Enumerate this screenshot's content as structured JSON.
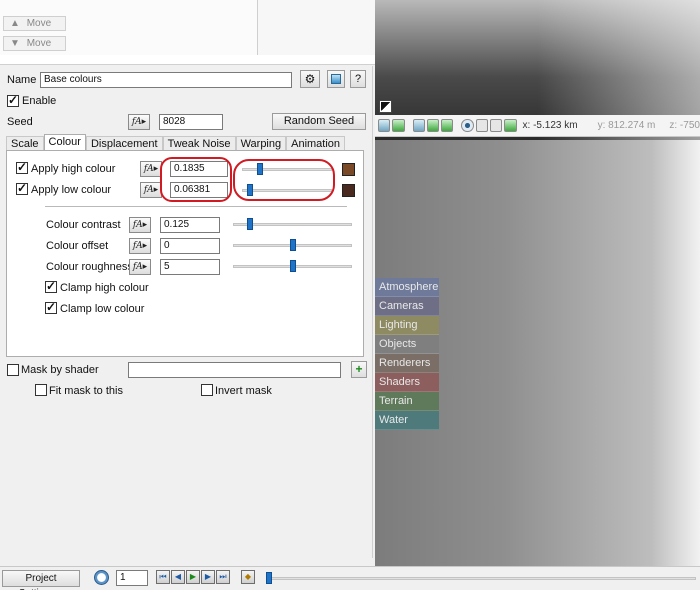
{
  "top_panel": {
    "move_up_label": "Move",
    "move_down_label": "Move"
  },
  "node": {
    "name_label": "Name",
    "name_value": "Base colours",
    "enable_label": "Enable",
    "enable_checked": true,
    "seed_label": "Seed",
    "seed_value": "8028",
    "random_seed_label": "Random Seed",
    "help_label": "?"
  },
  "tabs": [
    {
      "label": "Scale",
      "active": false
    },
    {
      "label": "Colour",
      "active": true
    },
    {
      "label": "Displacement",
      "active": false
    },
    {
      "label": "Tweak Noise",
      "active": false
    },
    {
      "label": "Warping",
      "active": false
    },
    {
      "label": "Animation",
      "active": false
    }
  ],
  "colour_tab": {
    "apply_high_label": "Apply high colour",
    "apply_high_value": "0.1835",
    "apply_high_fraction": 0.18,
    "high_colour": "#7a4a26",
    "apply_low_label": "Apply low colour",
    "apply_low_value": "0.06381",
    "apply_low_fraction": 0.06,
    "low_colour": "#4a2a1e",
    "contrast_label": "Colour contrast",
    "contrast_value": "0.125",
    "contrast_fraction": 0.12,
    "offset_label": "Colour offset",
    "offset_value": "0",
    "offset_fraction": 0.5,
    "roughness_label": "Colour roughness",
    "roughness_value": "5",
    "roughness_fraction": 0.5,
    "clamp_high_label": "Clamp high colour",
    "clamp_low_label": "Clamp low colour"
  },
  "mask": {
    "mask_label": "Mask by shader",
    "mask_value": "",
    "fit_label": "Fit mask to this",
    "invert_label": "Invert mask"
  },
  "viewport": {
    "coord_x": "x: -5.123 km",
    "coord_y": "y: 812.274 m",
    "coord_z": "z: -750"
  },
  "categories": [
    {
      "label": "Atmosphere",
      "color": "#6f7a9a"
    },
    {
      "label": "Cameras",
      "color": "#6e6f86"
    },
    {
      "label": "Lighting",
      "color": "#8e8a62"
    },
    {
      "label": "Objects",
      "color": "#7f7f7f"
    },
    {
      "label": "Renderers",
      "color": "#7a6e66"
    },
    {
      "label": "Shaders",
      "color": "#8c5e5e"
    },
    {
      "label": "Terrain",
      "color": "#5e7a5b"
    },
    {
      "label": "Water",
      "color": "#4f7a7c"
    }
  ],
  "bottom": {
    "project_settings_label": "Project Settings...",
    "frame_value": "1"
  }
}
